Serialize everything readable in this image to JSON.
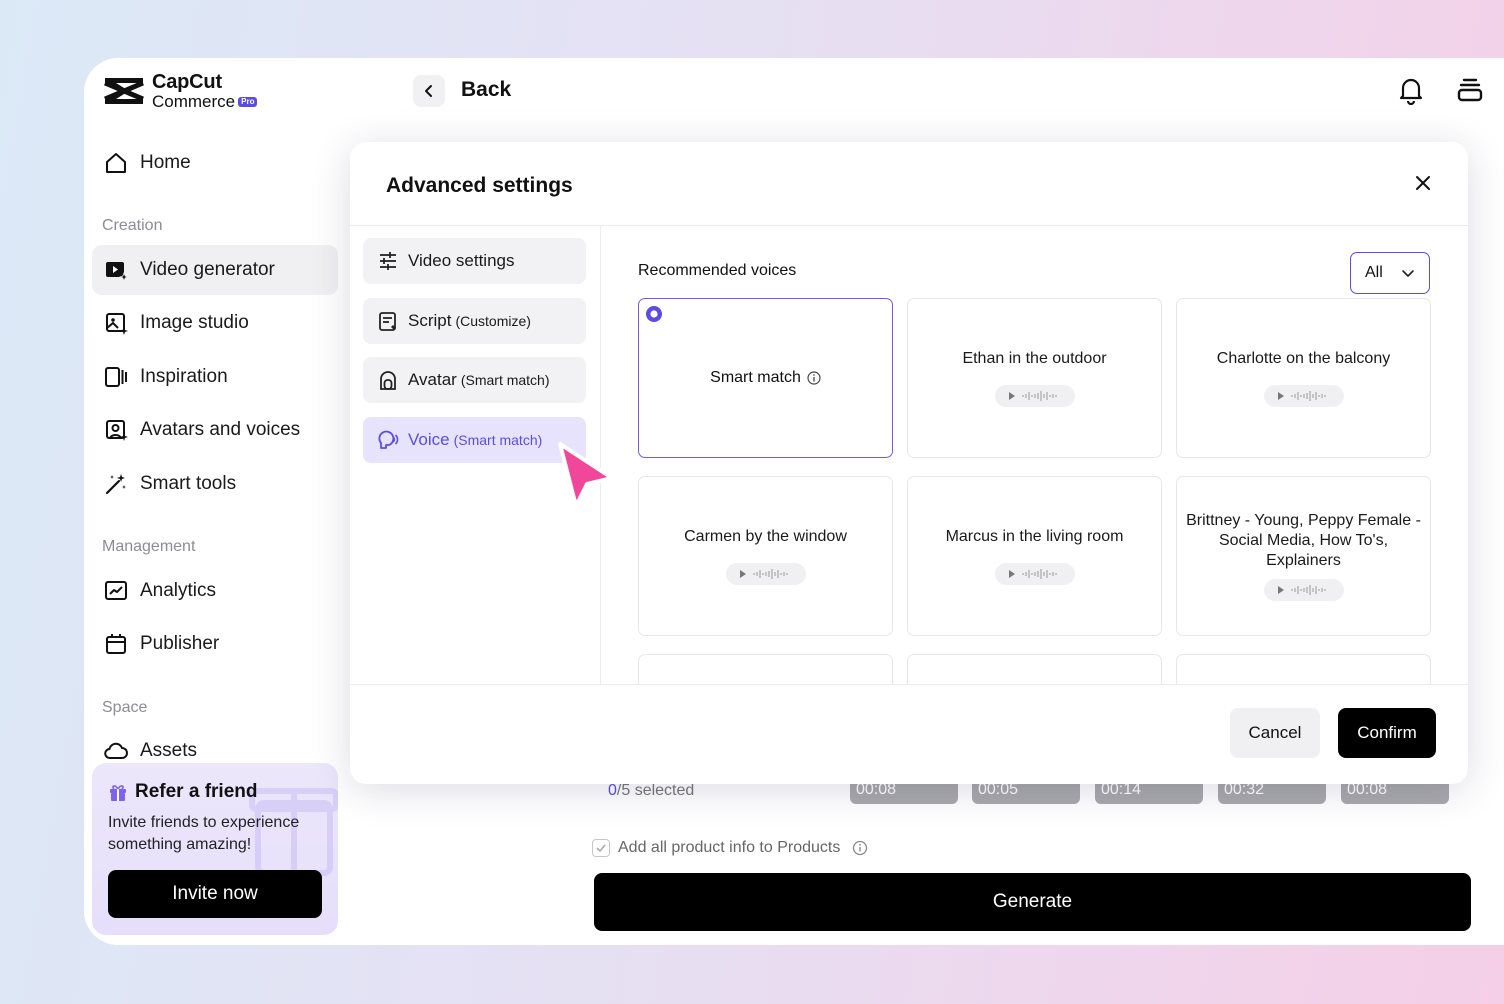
{
  "brand": {
    "line1": "CapCut",
    "line2": "Commerce",
    "badge": "Pro"
  },
  "header": {
    "back_label": "Back"
  },
  "sidebar": {
    "home": "Home",
    "section_creation": "Creation",
    "creation_items": [
      {
        "label": "Video generator",
        "icon": "video-generator-icon"
      },
      {
        "label": "Image studio",
        "icon": "image-studio-icon"
      },
      {
        "label": "Inspiration",
        "icon": "inspiration-icon"
      },
      {
        "label": "Avatars and voices",
        "icon": "avatar-icon"
      },
      {
        "label": "Smart tools",
        "icon": "magic-wand-icon"
      }
    ],
    "section_management": "Management",
    "management_items": [
      {
        "label": "Analytics",
        "icon": "analytics-icon"
      },
      {
        "label": "Publisher",
        "icon": "calendar-icon"
      }
    ],
    "section_space": "Space",
    "space_items": [
      {
        "label": "Assets",
        "icon": "cloud-icon"
      }
    ],
    "refer": {
      "title": "Refer a friend",
      "description": "Invite friends to experience something amazing!",
      "button": "Invite now"
    }
  },
  "page": {
    "selected_num": "0",
    "selected_rest": "/5 selected",
    "clips": [
      "00:08",
      "00:05",
      "00:14",
      "00:32",
      "00:08"
    ],
    "add_info_label": "Add all product info to Products",
    "generate_label": "Generate"
  },
  "modal": {
    "title": "Advanced settings",
    "menu": [
      {
        "label": "Video settings",
        "sub": ""
      },
      {
        "label": "Script",
        "sub": "(Customize)"
      },
      {
        "label": "Avatar",
        "sub": "(Smart match)"
      },
      {
        "label": "Voice",
        "sub": "(Smart match)"
      }
    ],
    "recommended_title": "Recommended voices",
    "filter_value": "All",
    "voices": [
      {
        "name": "Smart match",
        "selected": true
      },
      {
        "name": "Ethan in the outdoor",
        "selected": false
      },
      {
        "name": "Charlotte on the balcony",
        "selected": false
      },
      {
        "name": "Carmen by the window",
        "selected": false
      },
      {
        "name": "Marcus in the living room",
        "selected": false
      },
      {
        "name": "Brittney - Young, Peppy Female - Social Media, How To's, Explainers",
        "selected": false
      }
    ],
    "cancel_label": "Cancel",
    "confirm_label": "Confirm"
  },
  "colors": {
    "accent": "#5b4ce6",
    "accent_light": "#e8e3fd",
    "cursor": "#f0479a"
  }
}
